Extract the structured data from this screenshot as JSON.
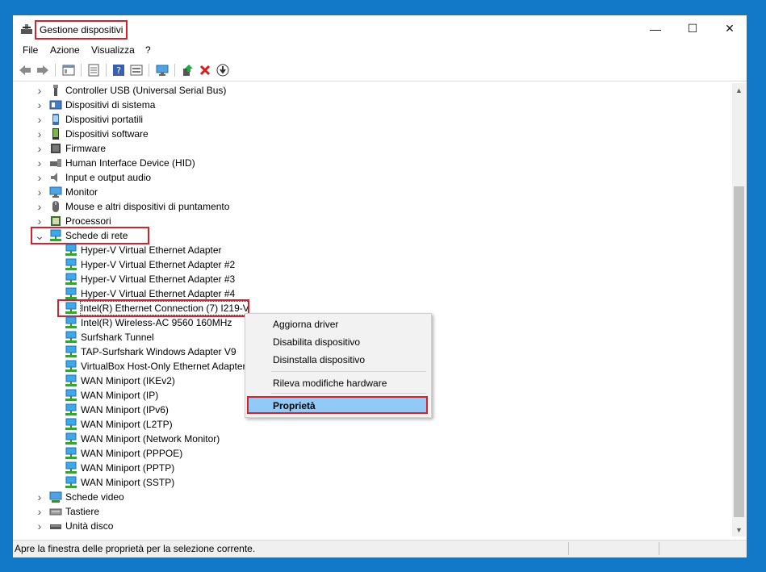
{
  "window": {
    "title": "Gestione dispositivi",
    "controls": {
      "minimize": "—",
      "maximize": "☐",
      "close": "✕"
    }
  },
  "menu": [
    "File",
    "Azione",
    "Visualizza",
    "?"
  ],
  "toolbar": [
    "back-icon",
    "forward-icon",
    "properties-icon",
    "list-icon",
    "help-icon",
    "view-icon",
    "monitor-icon",
    "update-driver-icon",
    "remove-icon",
    "download-icon"
  ],
  "tree": [
    {
      "label": "Controller USB (Universal Serial Bus)",
      "icon": "usb-icon",
      "expanded": false
    },
    {
      "label": "Dispositivi di sistema",
      "icon": "system-icon",
      "expanded": false
    },
    {
      "label": "Dispositivi portatili",
      "icon": "portable-icon",
      "expanded": false
    },
    {
      "label": "Dispositivi software",
      "icon": "software-icon",
      "expanded": false
    },
    {
      "label": "Firmware",
      "icon": "firmware-icon",
      "expanded": false
    },
    {
      "label": "Human Interface Device (HID)",
      "icon": "hid-icon",
      "expanded": false
    },
    {
      "label": "Input e output audio",
      "icon": "audio-icon",
      "expanded": false
    },
    {
      "label": "Monitor",
      "icon": "monitor-icon",
      "expanded": false
    },
    {
      "label": "Mouse e altri dispositivi di puntamento",
      "icon": "mouse-icon",
      "expanded": false
    },
    {
      "label": "Processori",
      "icon": "processor-icon",
      "expanded": false
    },
    {
      "label": "Schede di rete",
      "icon": "network-icon",
      "expanded": true
    },
    {
      "label": "Schede video",
      "icon": "video-icon",
      "expanded": false
    },
    {
      "label": "Tastiere",
      "icon": "keyboard-icon",
      "expanded": false
    },
    {
      "label": "Unità disco",
      "icon": "disk-icon",
      "expanded": false
    }
  ],
  "network_adapters": [
    "Hyper-V Virtual Ethernet Adapter",
    "Hyper-V Virtual Ethernet Adapter #2",
    "Hyper-V Virtual Ethernet Adapter #3",
    "Hyper-V Virtual Ethernet Adapter #4",
    "Intel(R) Ethernet Connection (7) I219-V",
    "Intel(R) Wireless-AC 9560 160MHz",
    "Surfshark Tunnel",
    "TAP-Surfshark Windows Adapter V9",
    "VirtualBox Host-Only Ethernet Adapter",
    "WAN Miniport (IKEv2)",
    "WAN Miniport (IP)",
    "WAN Miniport (IPv6)",
    "WAN Miniport (L2TP)",
    "WAN Miniport (Network Monitor)",
    "WAN Miniport (PPPOE)",
    "WAN Miniport (PPTP)",
    "WAN Miniport (SSTP)"
  ],
  "selected_adapter": "Intel(R) Ethernet Connection (7) I219-V",
  "context_menu": {
    "items": [
      "Aggiorna driver",
      "Disabilita dispositivo",
      "Disinstalla dispositivo"
    ],
    "scan": "Rileva modifiche hardware",
    "properties": "Proprietà"
  },
  "status": "Apre la finestra delle proprietà per la selezione corrente.",
  "colors": {
    "highlight": "#d9202a",
    "menu_selected": "#91c9f7",
    "desktop": "#1279c8"
  }
}
